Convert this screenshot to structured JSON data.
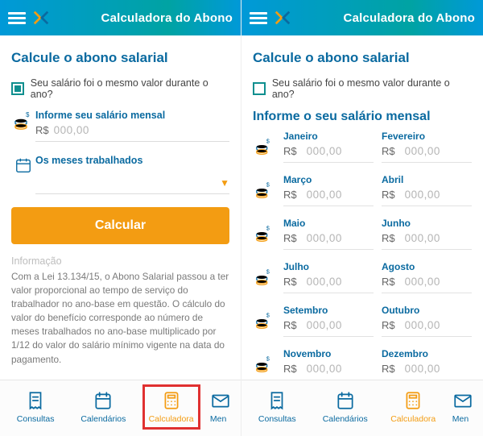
{
  "header": {
    "title": "Calculadora do Abono"
  },
  "page_title": "Calcule o abono salarial",
  "checkbox_label": "Seu salário foi o mesmo valor durante o ano?",
  "currency": "R$",
  "amount_zero": "000,00",
  "left": {
    "salary_label": "Informe seu salário mensal",
    "months_label": "Os meses trabalhados",
    "calc_button": "Calcular",
    "info_heading": "Informação",
    "info_body": "Com a Lei 13.134/15, o Abono Salarial passou a ter valor proporcional ao tempo de serviço do trabalhador no ano-base em questão. O cálculo do valor do benefício corresponde ao número de meses trabalhados no ano-base multiplicado por 1/12 do valor do salário mínimo vigente na data do pagamento."
  },
  "right": {
    "subtitle": "Informe o seu salário mensal",
    "months": [
      "Janeiro",
      "Fevereiro",
      "Março",
      "Abril",
      "Maio",
      "Junho",
      "Julho",
      "Agosto",
      "Setembro",
      "Outubro",
      "Novembro",
      "Dezembro"
    ]
  },
  "nav": {
    "consultas": "Consultas",
    "calendarios": "Calendários",
    "calculadora": "Calculadora",
    "mensagens_cut": "Men"
  }
}
